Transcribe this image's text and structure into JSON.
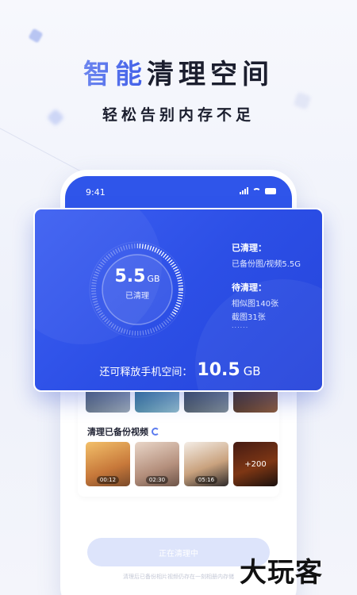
{
  "header": {
    "title_accent": "智能",
    "title_rest": "清理空间",
    "subtitle": "轻松告别内存不足"
  },
  "status_bar": {
    "time": "9:41"
  },
  "card": {
    "gauge_value": "5.5",
    "gauge_unit": "GB",
    "gauge_label": "已清理",
    "cleaned_heading": "已清理：",
    "cleaned_item": "已备份图/视频5.5G",
    "pending_heading": "待清理：",
    "pending_items": [
      "相似图140张",
      "截图31张"
    ],
    "pending_more": "......",
    "release_label": "还可释放手机空间：",
    "release_value": "10.5",
    "release_unit": "GB",
    "gauge_progress": 0.35
  },
  "photos": {
    "section_title": "清理已备份视频",
    "videos": [
      {
        "duration": "00:12"
      },
      {
        "duration": "02:30"
      },
      {
        "duration": "05:16"
      }
    ],
    "more_count": "+200"
  },
  "action": {
    "button_label": "正在清理中",
    "note": "清理后已备份相片视频仍存在一刻相册内存储"
  },
  "watermark": "大玩客"
}
